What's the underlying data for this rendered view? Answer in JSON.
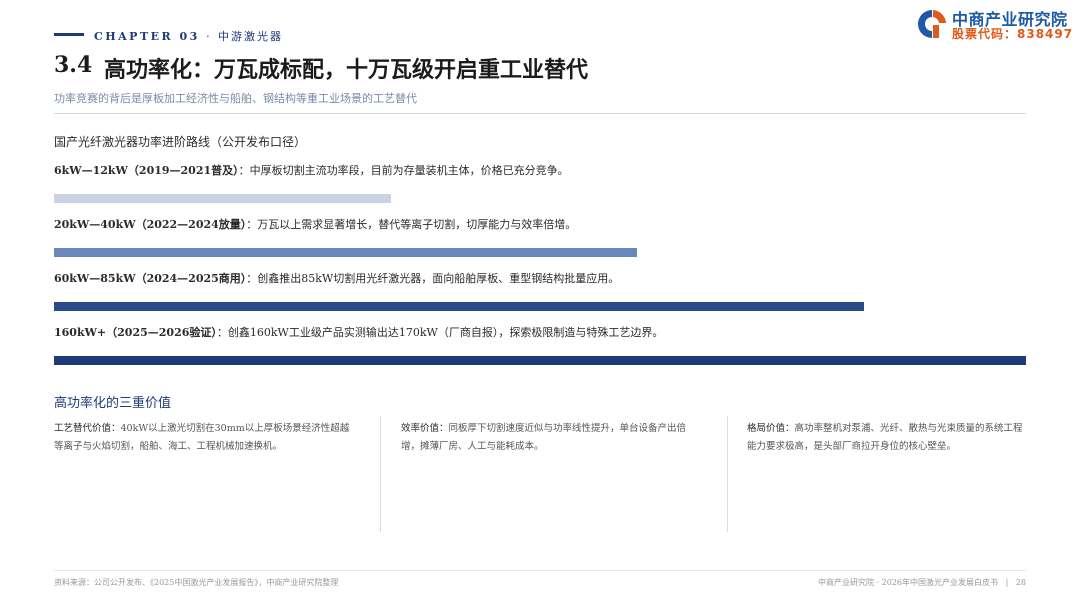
{
  "header": {
    "chapter": "CHAPTER 03",
    "separator": "·",
    "chapter_name": "中游激光器",
    "logo_name": "中商产业研究院",
    "logo_code": "股票代码：838497",
    "colors": {
      "brand_blue": "#1e5aa8",
      "brand_orange": "#e05a1c",
      "navy": "#1f3a78"
    }
  },
  "title": {
    "number": "3.4",
    "text": "高功率化：万瓦成标配，十万瓦级开启重工业替代",
    "subtitle": "功率竞赛的背后是厚板加工经济性与船舶、钢结构等重工业场景的工艺替代"
  },
  "roadmap": {
    "label": "国产光纤激光器功率进阶路线（公开发布口径）",
    "rows": [
      {
        "head": "6kW—12kW（2019—2021普及）",
        "desc": "：中厚板切割主流功率段，目前为存量装机主体，价格已充分竞争。",
        "level": 0.347,
        "color": "#c9d3e3"
      },
      {
        "head": "20kW—40kW（2022—2024放量）",
        "desc": "：万瓦以上需求显著增长，替代等离子切割，切厚能力与效率倍增。",
        "level": 0.6,
        "color": "#6b86bb"
      },
      {
        "head": "60kW—85kW（2024—2025商用）",
        "desc": "：创鑫推出85kW切割用光纤激光器，面向船舶厚板、重型钢结构批量应用。",
        "level": 0.833,
        "color": "#2a4a8c"
      },
      {
        "head": "160kW+（2025—2026验证）",
        "desc": "：创鑫160kW工业级产品实测输出达170kW（厂商自报），探索极限制造与特殊工艺边界。",
        "level": 1.0,
        "color": "#1f3a78"
      }
    ]
  },
  "values": {
    "title": "高功率化的三重价值",
    "columns": [
      {
        "key": "工艺替代价值：",
        "text": "40kW以上激光切割在30mm以上厚板场景经济性超越等离子与火焰切割，船舶、海工、工程机械加速换机。"
      },
      {
        "key": "效率价值：",
        "text": "同板厚下切割速度近似与功率线性提升，单台设备产出倍增，摊薄厂房、人工与能耗成本。"
      },
      {
        "key": "格局价值：",
        "text": "高功率整机对泵浦、光纤、散热与光束质量的系统工程能力要求极高，是头部厂商拉开身位的核心壁垒。"
      }
    ]
  },
  "footer": {
    "source": "资料来源：公司公开发布、《2025中国激光产业发展报告》，中商产业研究院整理",
    "right": "中商产业研究院 · 2026年中国激光产业发展白皮书",
    "divider": "|",
    "page": "28"
  }
}
